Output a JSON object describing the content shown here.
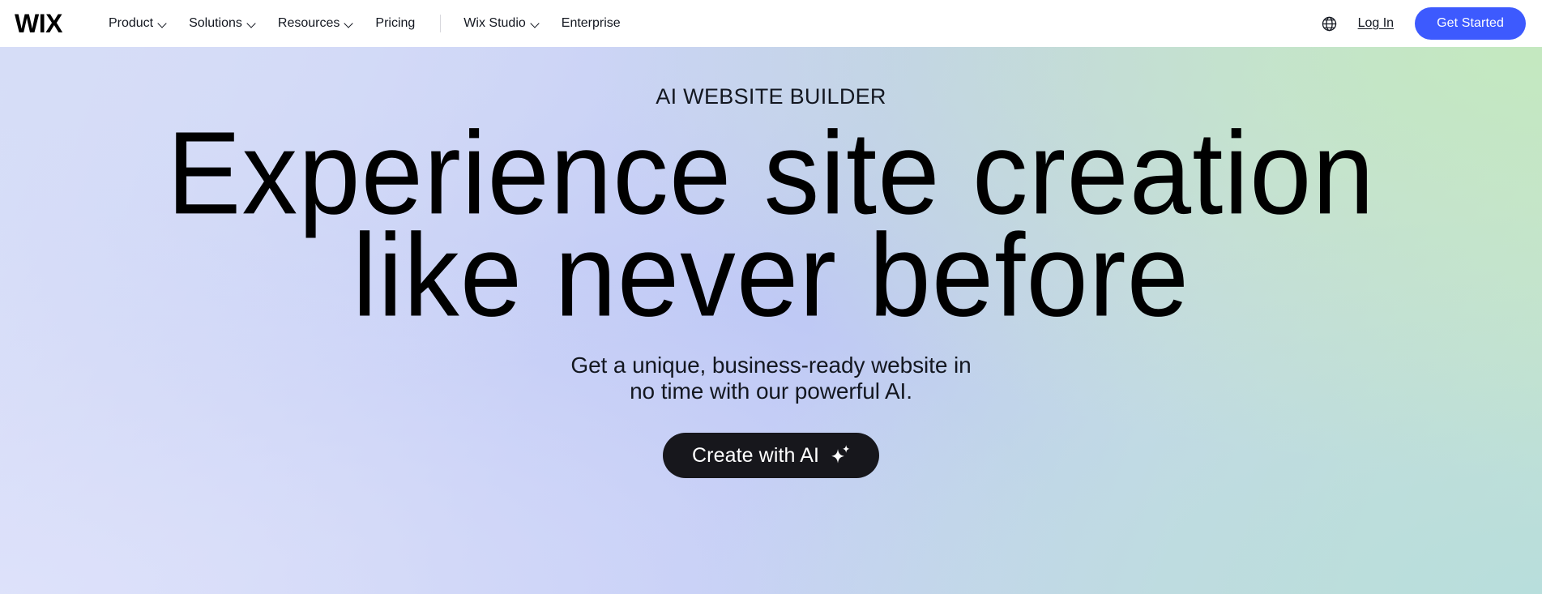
{
  "header": {
    "logo_text": "WIX",
    "nav_items": [
      {
        "label": "Product",
        "has_chevron": true
      },
      {
        "label": "Solutions",
        "has_chevron": true
      },
      {
        "label": "Resources",
        "has_chevron": true
      },
      {
        "label": "Pricing",
        "has_chevron": false
      },
      {
        "label": "Wix Studio",
        "has_chevron": true
      },
      {
        "label": "Enterprise",
        "has_chevron": false
      }
    ],
    "language_icon": "globe-icon",
    "login_label": "Log In",
    "get_started_label": "Get Started",
    "get_started_color": "#3d5afe",
    "background_color": "#ffffff"
  },
  "hero": {
    "eyebrow": "AI WEBSITE BUILDER",
    "headline_line_1": "Experience site creation",
    "headline_line_2": "like never before",
    "subhead_line_1": "Get a unique, business-ready website in",
    "subhead_line_2": "no time with our powerful AI.",
    "cta_label": "Create with AI",
    "cta_icon": "sparkle-icon",
    "cta_background": "#17171c",
    "cta_text_color": "#ffffff",
    "text_color": "#131720",
    "gradient": {
      "top_left": "#d6ddf7",
      "top_right": "#c3e8c0",
      "bottom_left": "#dee2f8",
      "bottom_right": "#bedcdc",
      "center": "#bfc9f5"
    }
  }
}
